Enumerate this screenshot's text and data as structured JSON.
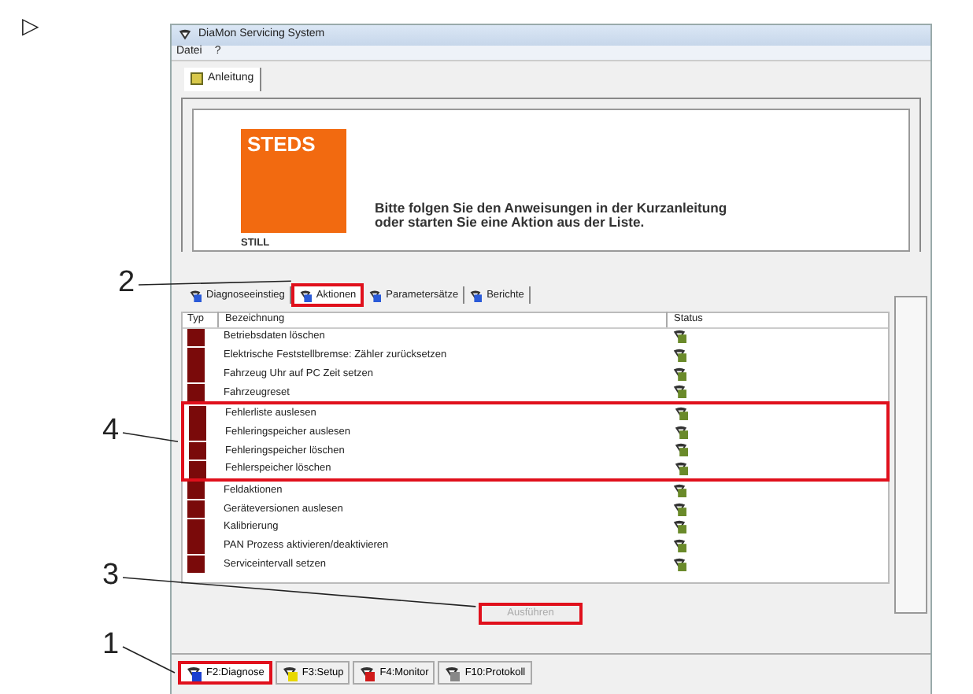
{
  "page_marker": "▷",
  "window": {
    "title": "DiaMon Servicing System"
  },
  "menu": [
    "Datei",
    "?"
  ],
  "top_tabs": [
    {
      "label": "Anleitung",
      "selected": true
    }
  ],
  "banner": {
    "logo": "STEDS",
    "brand": "STILL",
    "message_lines": [
      "Bitte folgen Sie den Anweisungen in der Kurzanleitung",
      "oder starten Sie eine Aktion aus der Liste."
    ]
  },
  "tabs": [
    {
      "label": "Diagnoseeinstieg",
      "selected": false,
      "highlighted": false
    },
    {
      "label": "Aktionen",
      "selected": true,
      "highlighted": true
    },
    {
      "label": "Parametersätze",
      "selected": false,
      "highlighted": false
    },
    {
      "label": "Berichte",
      "selected": false,
      "highlighted": false
    }
  ],
  "table": {
    "columns": [
      "Typ",
      "Bezeichnung",
      "Status"
    ],
    "rows": [
      {
        "name": "Betriebsdaten löschen",
        "highlighted": false
      },
      {
        "name": "Elektrische Feststellbremse: Zähler zurücksetzen",
        "highlighted": false
      },
      {
        "name": "Fahrzeug Uhr auf PC Zeit setzen",
        "highlighted": false
      },
      {
        "name": "Fahrzeugreset",
        "highlighted": false
      },
      {
        "name": "Fehlerliste auslesen",
        "highlighted": true
      },
      {
        "name": "Fehleringspeicher auslesen",
        "highlighted": true
      },
      {
        "name": "Fehleringspeicher löschen",
        "highlighted": true
      },
      {
        "name": "Fehlerspeicher löschen",
        "highlighted": true
      },
      {
        "name": "Feldaktionen",
        "highlighted": false
      },
      {
        "name": "Geräteversionen auslesen",
        "highlighted": false
      },
      {
        "name": "Kalibrierung",
        "highlighted": false
      },
      {
        "name": "PAN Prozess aktivieren/deaktivieren",
        "highlighted": false
      },
      {
        "name": "Serviceintervall setzen",
        "highlighted": false
      }
    ]
  },
  "run_button": {
    "label": "Ausführen",
    "disabled": true,
    "highlighted": true
  },
  "bottom_buttons": [
    {
      "label": "F2:Diagnose",
      "selected": true,
      "highlighted": true,
      "color": "#1a3fd0"
    },
    {
      "label": "F3:Setup",
      "selected": false,
      "highlighted": false,
      "color": "#e8d800"
    },
    {
      "label": "F4:Monitor",
      "selected": false,
      "highlighted": false,
      "color": "#d01a1a"
    },
    {
      "label": "F10:Protokoll",
      "selected": false,
      "highlighted": false,
      "color": "#888888"
    }
  ],
  "callouts": [
    "2",
    "4",
    "3",
    "1"
  ]
}
